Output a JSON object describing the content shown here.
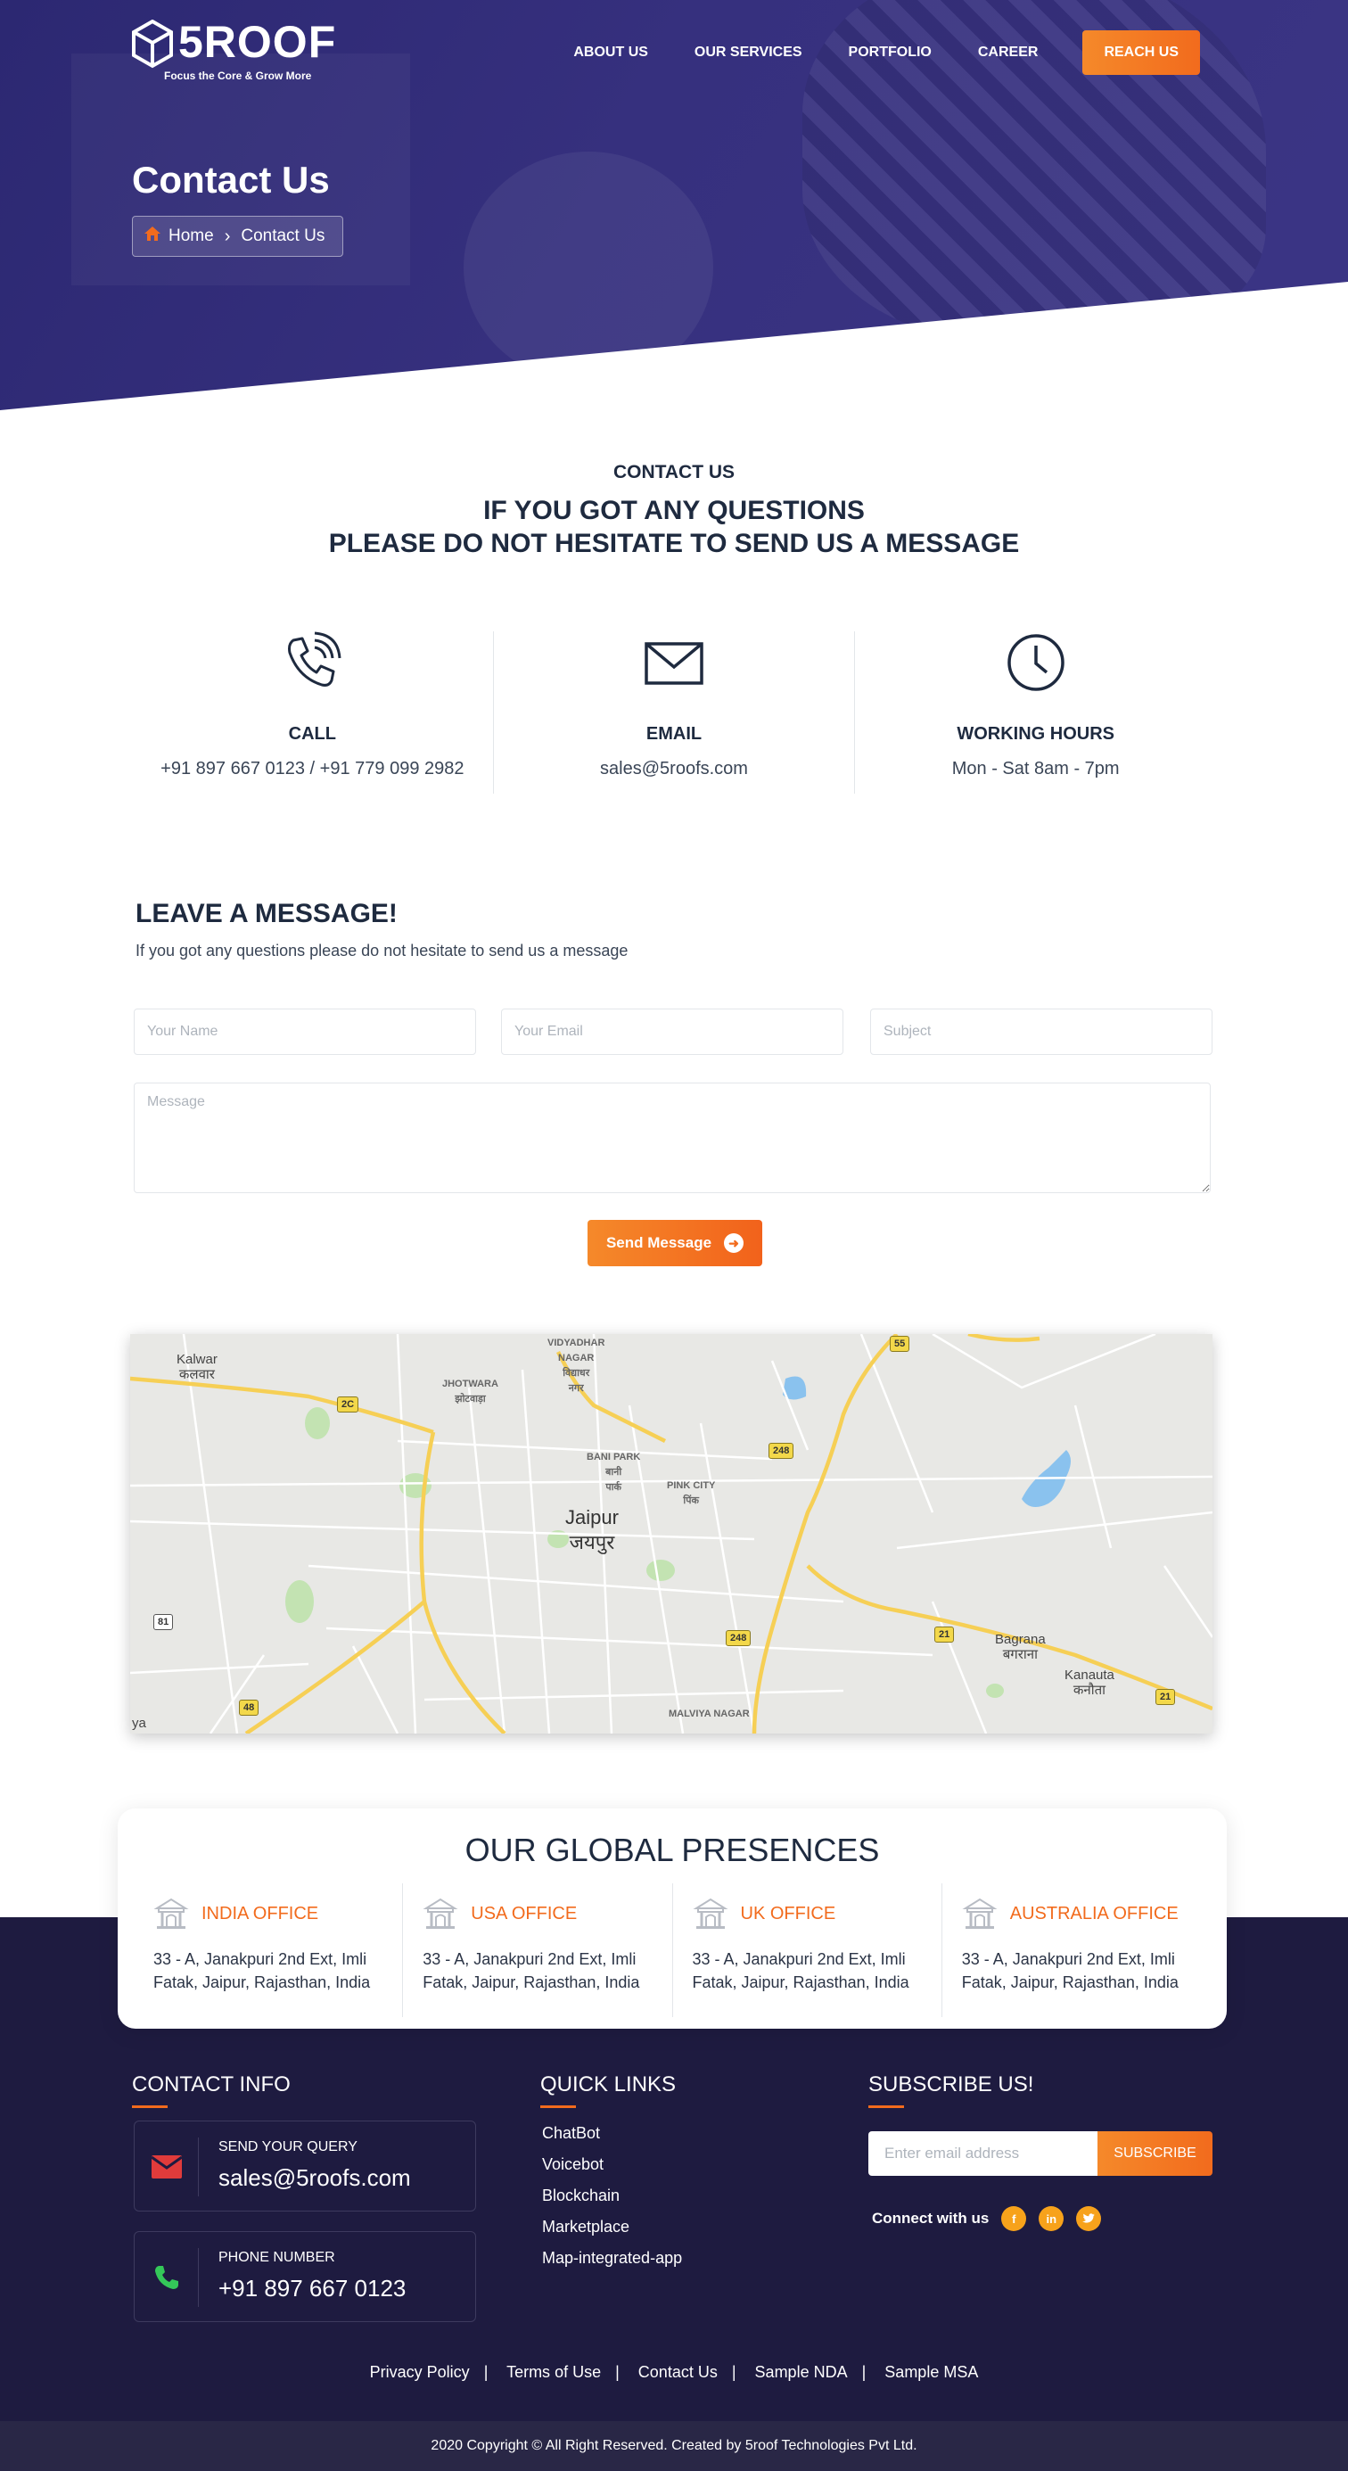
{
  "brand": {
    "name": "5ROOF",
    "tagline": "Focus the Core & Grow More"
  },
  "nav": {
    "items": [
      "ABOUT US",
      "OUR SERVICES",
      "PORTFOLIO",
      "CAREER"
    ],
    "cta": "REACH US"
  },
  "hero": {
    "title": "Contact Us",
    "breadcrumb": {
      "home": "Home",
      "current": "Contact Us"
    }
  },
  "contact_section": {
    "kicker": "CONTACT US",
    "heading_line1": "IF YOU GOT ANY QUESTIONS",
    "heading_line2": "PLEASE DO NOT HESITATE TO SEND US A MESSAGE",
    "columns": [
      {
        "icon": "phone-icon",
        "title": "CALL",
        "value": "+91 897 667 0123 / +91 779 099 2982"
      },
      {
        "icon": "envelope-icon",
        "title": "EMAIL",
        "value": "sales@5roofs.com"
      },
      {
        "icon": "clock-icon",
        "title": "WORKING HOURS",
        "value": "Mon - Sat 8am - 7pm"
      }
    ]
  },
  "form": {
    "title": "LEAVE A MESSAGE!",
    "subtitle": "If you got any questions please do not hesitate to send us a message",
    "name_placeholder": "Your Name",
    "email_placeholder": "Your Email",
    "subject_placeholder": "Subject",
    "message_placeholder": "Message",
    "submit": "Send Message"
  },
  "map": {
    "labels": {
      "kalwar": "Kalwar",
      "kalwar_hi": "कलवार",
      "vidyadhar": "VIDYADHAR",
      "vidyadhar2": "NAGAR",
      "vidyadhar_hi": "विद्याधर",
      "vidyadhar_hi2": "नगर",
      "jhotwara": "JHOTWARA",
      "jhotwara_hi": "झोटवाड़ा",
      "bani": "BANI PARK",
      "bani_hi": "बानी",
      "bani_hi2": "पार्क",
      "pink": "PINK CITY",
      "pink_hi": "पिंक",
      "jaipur": "Jaipur",
      "jaipur_hi": "जयपुर",
      "bagrana": "Bagrana",
      "bagrana_hi": "बगराना",
      "kanauta": "Kanauta",
      "kanauta_hi": "कनौता",
      "malviya": "MALVIYA NAGAR",
      "ya": "ya"
    },
    "shields": {
      "s55": "55",
      "s2c": "2C",
      "s248a": "248",
      "s248b": "248",
      "s21a": "21",
      "s21b": "21",
      "s81": "81",
      "s48": "48"
    },
    "colors": {
      "road": "#f6cf55",
      "street": "#ffffff",
      "water": "#8ac2ee",
      "park": "#c3e3b2",
      "land": "#e8e8e5"
    }
  },
  "global": {
    "title": "OUR GLOBAL PRESENCES",
    "offices": [
      {
        "name": "INDIA OFFICE",
        "line1": "33 - A, Janakpuri 2nd Ext, Imli",
        "line2": "Fatak, Jaipur, Rajasthan, India"
      },
      {
        "name": "USA OFFICE",
        "line1": "33 - A, Janakpuri 2nd Ext, Imli",
        "line2": "Fatak, Jaipur, Rajasthan, India"
      },
      {
        "name": "UK OFFICE",
        "line1": "33 - A, Janakpuri 2nd Ext, Imli",
        "line2": "Fatak, Jaipur, Rajasthan, India"
      },
      {
        "name": "AUSTRALIA OFFICE",
        "line1": "33 - A, Janakpuri 2nd Ext, Imli",
        "line2": "Fatak, Jaipur, Rajasthan, India"
      }
    ]
  },
  "footer": {
    "contact_title": "CONTACT INFO",
    "query_label": "SEND YOUR QUERY",
    "query_value": "sales@5roofs.com",
    "phone_label": "PHONE NUMBER",
    "phone_value": "+91 897 667 0123",
    "links_title": "QUICK LINKS",
    "links": [
      "ChatBot",
      "Voicebot",
      "Blockchain",
      "Marketplace",
      "Map-integrated-app"
    ],
    "subscribe_title": "SUBSCRIBE US!",
    "subscribe_placeholder": "Enter email address",
    "subscribe_button": "SUBSCRIBE",
    "connect_label": "Connect with us",
    "social": {
      "facebook": "f",
      "linkedin": "in",
      "twitter": "t"
    },
    "legal": [
      "Privacy Policy",
      "Terms of Use",
      "Contact Us",
      "Sample NDA",
      "Sample MSA"
    ],
    "legal_sep": "|",
    "copyright": "2020 Copyright © All Right Reserved. Created by 5roof Technologies Pvt Ltd."
  },
  "colors": {
    "primary": "#2c2872",
    "accent": "#f26b1d",
    "footer": "#1e1b40",
    "text": "#1e2a3f"
  }
}
